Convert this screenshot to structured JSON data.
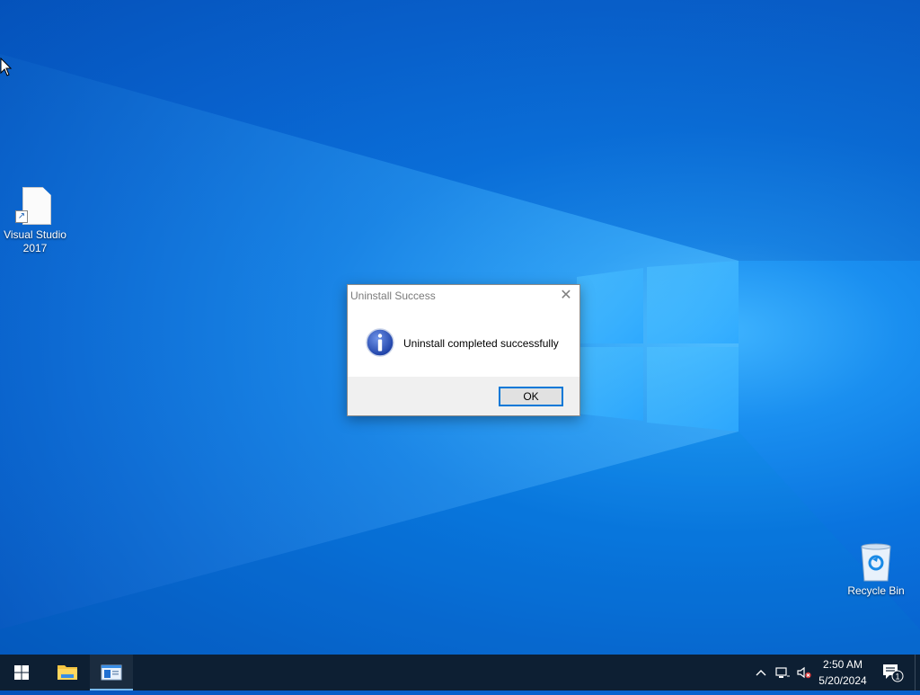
{
  "desktop": {
    "icons": [
      {
        "name": "visual-studio-2017",
        "label_line1": "Visual Studio",
        "label_line2": "2017"
      },
      {
        "name": "recycle-bin",
        "label": "Recycle Bin"
      }
    ]
  },
  "dialog": {
    "title": "Uninstall Success",
    "message": "Uninstall completed successfully",
    "ok_label": "OK",
    "close_glyph": "✕",
    "icon": "info-icon"
  },
  "taskbar": {
    "start_icon": "windows-logo-icon",
    "pinned": [
      "file-explorer-icon",
      "app-window-icon"
    ],
    "tray": {
      "chevron": "^",
      "network_icon": "network-icon",
      "volume_icon": "volume-muted-icon",
      "time": "2:50 AM",
      "date": "5/20/2024",
      "notification_count": "1"
    }
  },
  "colors": {
    "accent": "#0078d7",
    "taskbar": "#0d1f33",
    "desktop": "#0a74df"
  }
}
